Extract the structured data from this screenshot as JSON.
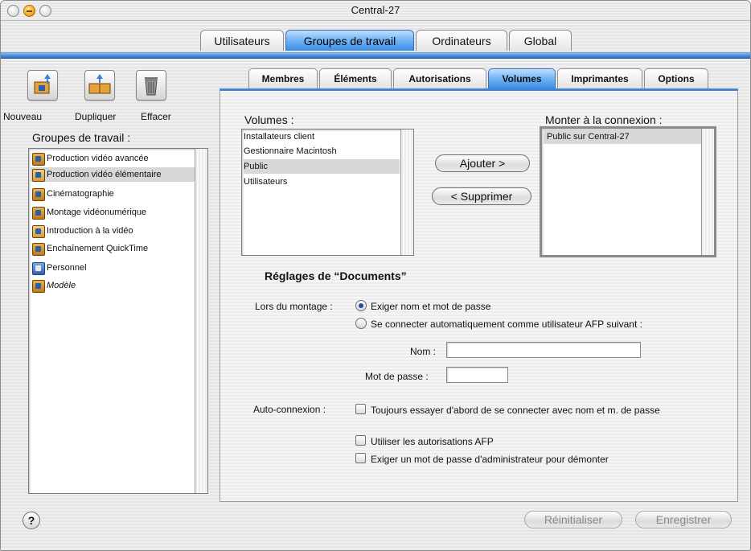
{
  "window": {
    "title": "Central-27"
  },
  "top_tabs": [
    "Utilisateurs",
    "Groupes de travail",
    "Ordinateurs",
    "Global"
  ],
  "top_tab_active": "Groupes de travail",
  "toolbar": {
    "new_label": "Nouveau",
    "duplicate_label": "Dupliquer",
    "delete_label": "Effacer"
  },
  "groups": {
    "header": "Groupes de travail :",
    "items": [
      {
        "label": "Production vidéo avancée",
        "icon": "workgroup-icon",
        "selected": false
      },
      {
        "label": "Production vidéo élémentaire",
        "icon": "workgroup-icon",
        "selected": true
      },
      {
        "label": "Cinématographie",
        "icon": "workgroup-icon",
        "selected": false
      },
      {
        "label": "Montage vidéonumérique",
        "icon": "workgroup-icon",
        "selected": false
      },
      {
        "label": "Introduction à la vidéo",
        "icon": "workgroup-icon",
        "selected": false
      },
      {
        "label": "Enchaînement QuickTime",
        "icon": "workgroup-icon",
        "selected": false
      },
      {
        "label": "Personnel",
        "icon": "workgroup-icon",
        "selected": false
      },
      {
        "label": "Modèle",
        "icon": "workgroup-icon",
        "selected": false
      }
    ]
  },
  "sub_tabs": [
    "Membres",
    "Éléments",
    "Autorisations",
    "Volumes",
    "Imprimantes",
    "Options"
  ],
  "sub_tab_active": "Volumes",
  "volumes": {
    "label": "Volumes :",
    "items": [
      "Installateurs client",
      "Gestionnaire Macintosh",
      "Public",
      "Utilisateurs"
    ],
    "selected": "Public"
  },
  "buttons": {
    "add": "Ajouter >",
    "remove": "< Supprimer"
  },
  "mount": {
    "label": "Monter à la connexion :",
    "items": [
      "Public sur Central-27"
    ]
  },
  "settings": {
    "title": "Réglages de “Documents”",
    "on_mount_label": "Lors du montage :",
    "radio_require": "Exiger nom et mot de passe",
    "radio_auto": "Se connecter automatiquement comme utilisateur AFP suivant :",
    "name_label": "Nom :",
    "name_value": "",
    "password_label": "Mot de passe :",
    "password_value": "",
    "autoconnect_label": "Auto-connexion :",
    "check_try_first": "Toujours essayer d'abord de se connecter avec nom et m. de passe",
    "check_afp_privs": "Utiliser les autorisations AFP",
    "check_admin_pw": "Exiger un mot de passe d'administrateur pour démonter"
  },
  "footer": {
    "help": "?",
    "revert": "Réinitialiser",
    "save": "Enregistrer"
  },
  "colors": {
    "accent": "#3c8ce6",
    "selection": "#d8d8d8"
  }
}
